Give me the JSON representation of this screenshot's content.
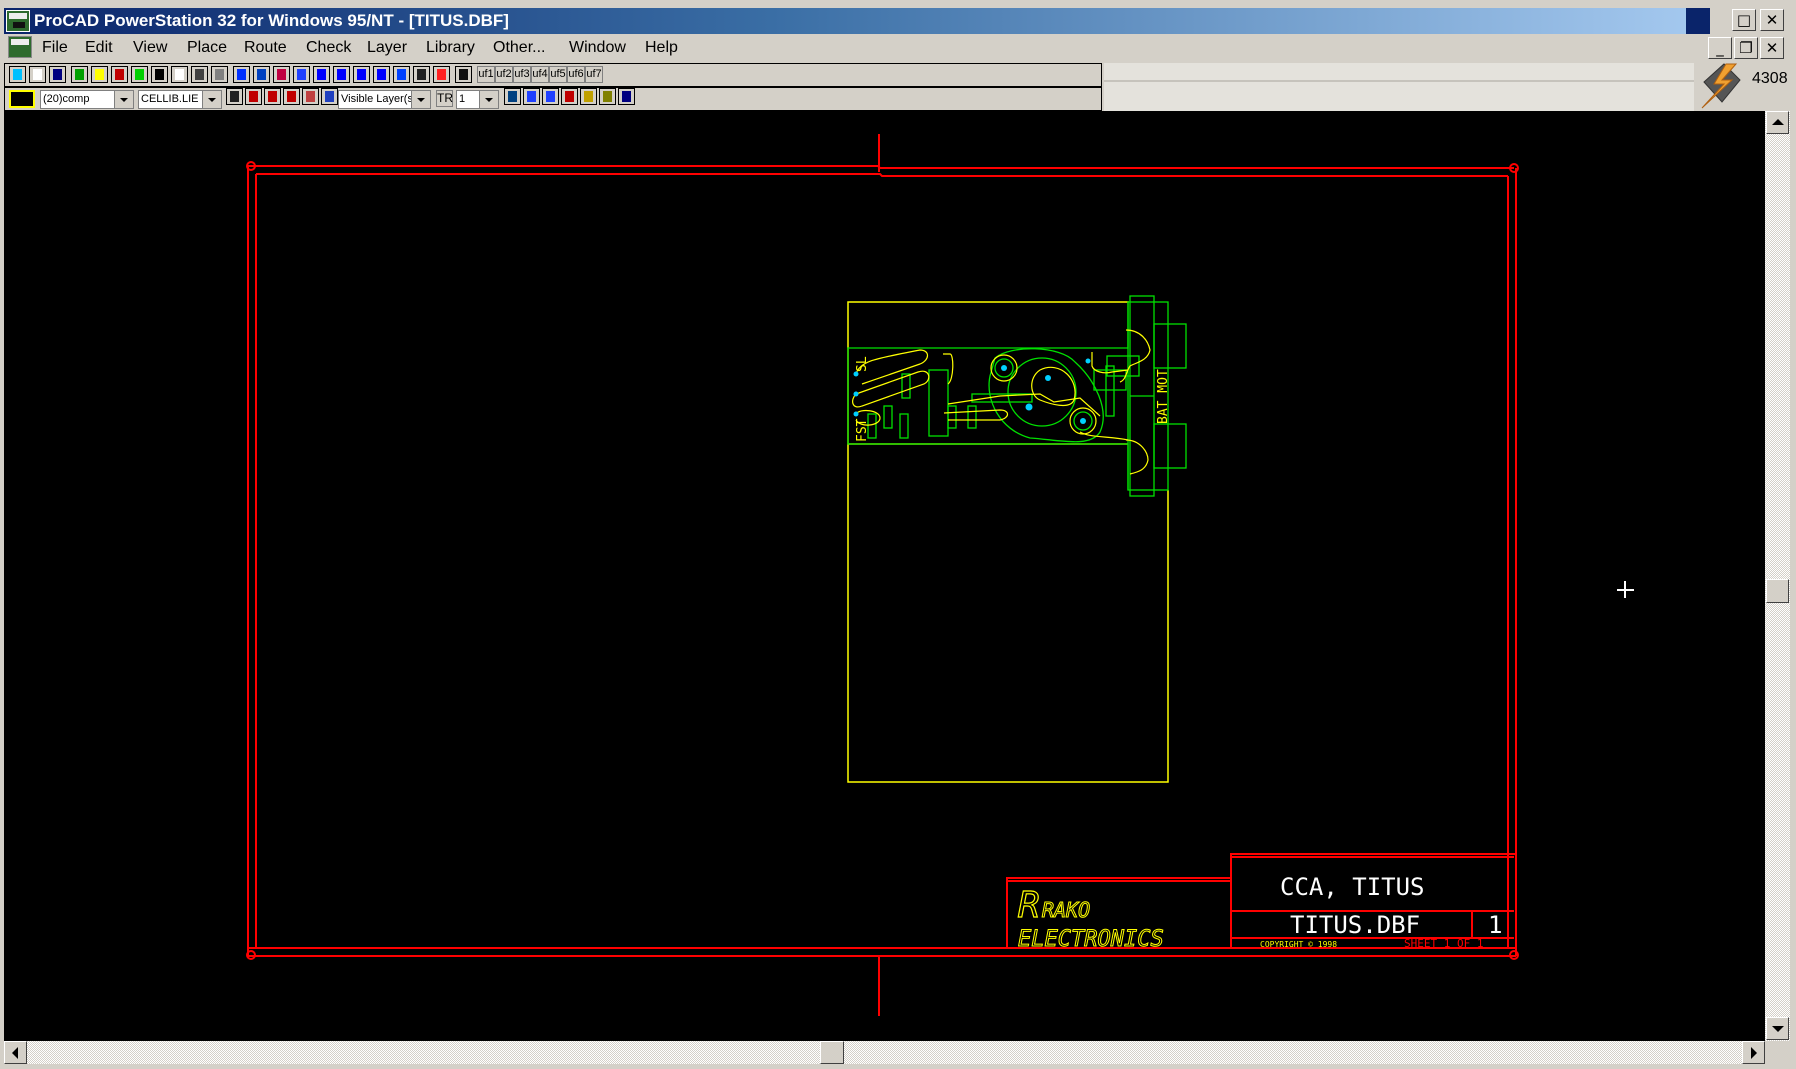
{
  "window": {
    "title": "ProCAD PowerStation 32 for Windows 95/NT - [TITUS.DBF]",
    "maximize_glyph": "□",
    "close_glyph": "✕",
    "minimize_glyph": "_",
    "restore_glyph": "❐"
  },
  "menu": [
    "File",
    "Edit",
    "View",
    "Place",
    "Route",
    "Check",
    "Layer",
    "Library",
    "Other...",
    "Window",
    "Help"
  ],
  "toolbar1": {
    "icons": [
      "new-file",
      "open-file",
      "save",
      "component",
      "library-edit",
      "refresh",
      "netlist",
      "part",
      "pad",
      "via",
      "text-block",
      "place-part",
      "route",
      "unroute",
      "edit-route",
      "trace",
      "circle",
      "filled-circle",
      "rectangle",
      "text",
      "pin",
      "dimension",
      "print"
    ],
    "user_functions": [
      "uf1",
      "uf2",
      "uf3",
      "uf4",
      "uf5",
      "uf6",
      "uf7"
    ]
  },
  "toolbar2": {
    "layer_select": "(20)comp",
    "library_select": "CELLIB.LIE",
    "visible_layers_select": "Visible Layer(s",
    "tr_label": "TR",
    "grid_select": "1",
    "icons_left": [
      "properties",
      "check-mark",
      "select-arrow",
      "select-red",
      "select-partial",
      "layer-colors"
    ],
    "icons_right": [
      "zoom-fit",
      "zoom-in",
      "zoom-out",
      "redraw",
      "home",
      "pan",
      "snap"
    ]
  },
  "status_counter": "4308",
  "drawing": {
    "title_block": {
      "company_line1": "RAKO",
      "company_line2": "ELECTRONICS",
      "title": "CCA, TITUS",
      "filename": "TITUS.DBF",
      "revision": "1",
      "copyright": "COPYRIGHT © 1998",
      "sheet": "SHEET 1 OF 1"
    },
    "labels": {
      "sl": "SL",
      "fst": "FST",
      "bat_mot": "BAT MOT"
    },
    "colors": {
      "border": "#ff0000",
      "board_outline": "#ffff00",
      "silkscreen": "#00e000",
      "drill": "#00d0ff",
      "cursor": "#ffffff"
    }
  }
}
